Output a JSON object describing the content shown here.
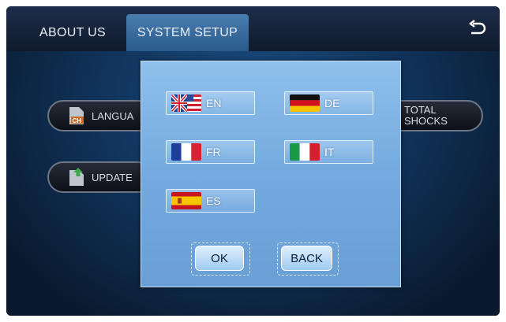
{
  "tabs": [
    {
      "label": "ABOUT US",
      "active": false
    },
    {
      "label": "SYSTEM SETUP",
      "active": true
    }
  ],
  "background_items": {
    "language_label": "LANGUA",
    "update_label": "UPDATE",
    "total_shocks_line1": "TOTAL",
    "total_shocks_line2": "SHOCKS"
  },
  "language_dialog": {
    "languages": [
      {
        "code": "EN",
        "flag": "uk-us-flag-icon"
      },
      {
        "code": "DE",
        "flag": "germany-flag-icon"
      },
      {
        "code": "FR",
        "flag": "france-flag-icon"
      },
      {
        "code": "IT",
        "flag": "italy-flag-icon"
      },
      {
        "code": "ES",
        "flag": "spain-flag-icon"
      }
    ],
    "ok_label": "OK",
    "back_label": "BACK"
  },
  "colors": {
    "dialog": "#7fb4e6",
    "active_tab": "#3c6fa3",
    "screen_bg": "#0c1320"
  }
}
